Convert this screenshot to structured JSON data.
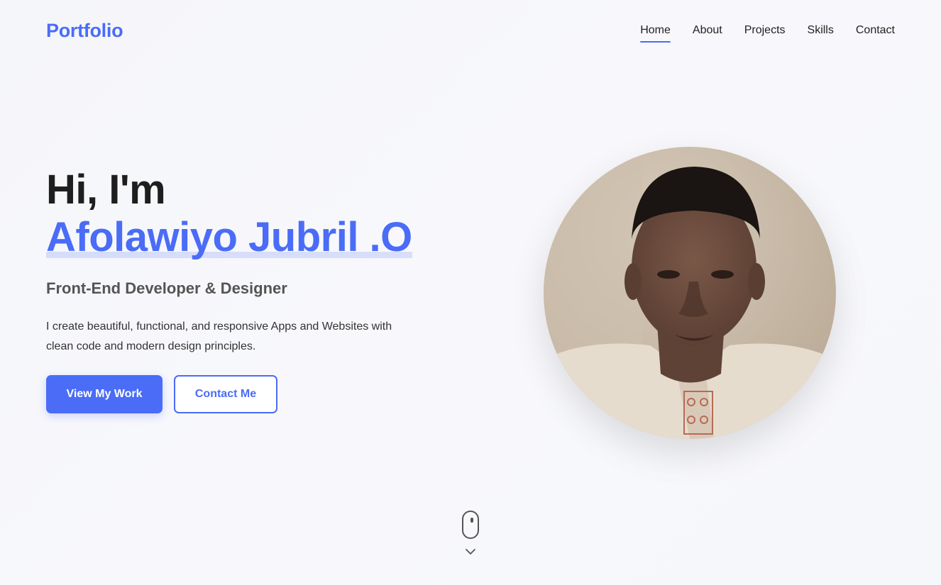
{
  "navbar": {
    "logo": "Portfolio",
    "links": [
      "Home",
      "About",
      "Projects",
      "Skills",
      "Contact"
    ],
    "active_link": "Home"
  },
  "hero": {
    "greeting": "Hi, I'm",
    "name": "Afolawiyo Jubril .O",
    "role": "Front-End Developer & Designer",
    "description": "I create beautiful, functional, and responsive Apps and Websites with clean code and modern design principles.",
    "primary_button": "View My Work",
    "secondary_button": "Contact Me"
  },
  "profile_image": {
    "icon": "profile-photo"
  },
  "scroll_indicator": {
    "icons": [
      "mouse-icon",
      "chevron-down-icon"
    ]
  },
  "colors": {
    "accent": "#4a6cf7",
    "text_dark": "#1e1e1e",
    "text_muted": "#555555",
    "background": "#f6f7fb"
  }
}
